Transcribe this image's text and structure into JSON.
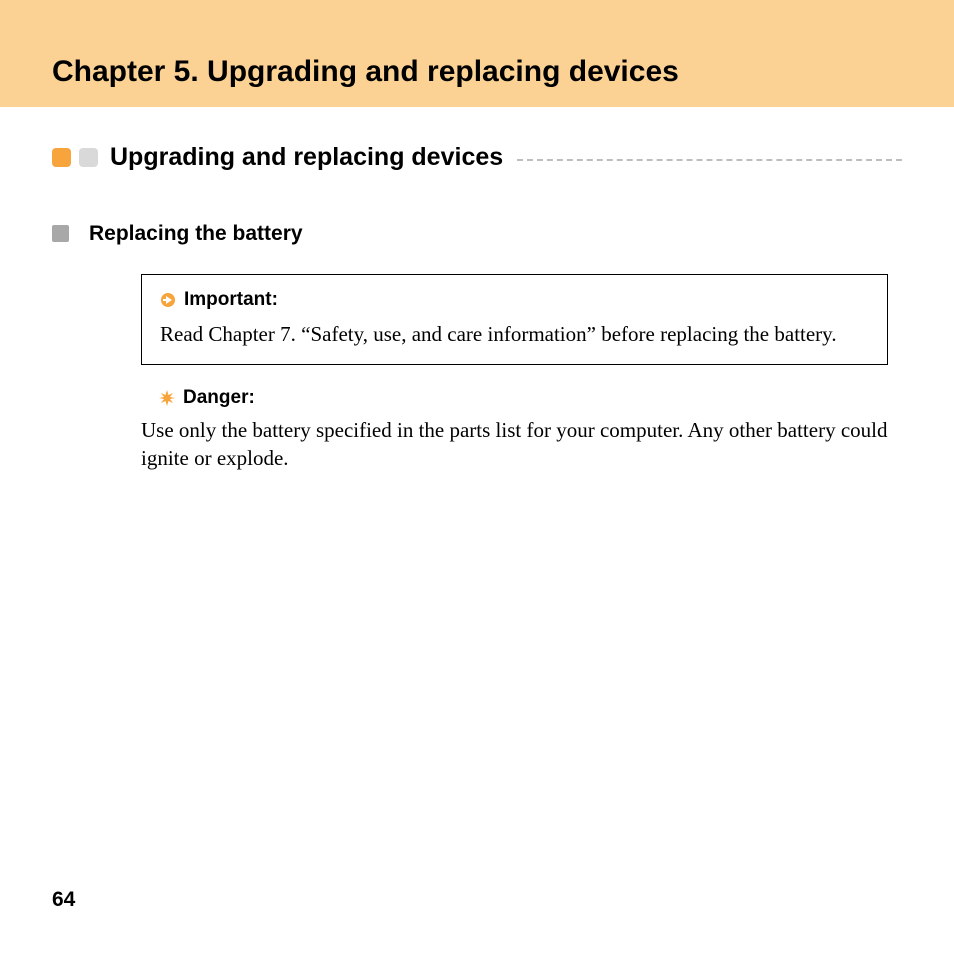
{
  "header": {
    "chapter_title": "Chapter 5. Upgrading and replacing devices"
  },
  "section": {
    "title": "Upgrading and replacing devices"
  },
  "subsection": {
    "title": "Replacing the battery"
  },
  "important": {
    "label": "Important:",
    "text": "Read Chapter 7. “Safety, use, and care information” before replacing the battery."
  },
  "danger": {
    "label": "Danger:",
    "text": "Use only the battery specified in the parts list for your computer. Any other battery could ignite or explode."
  },
  "footer": {
    "page_number": "64"
  }
}
